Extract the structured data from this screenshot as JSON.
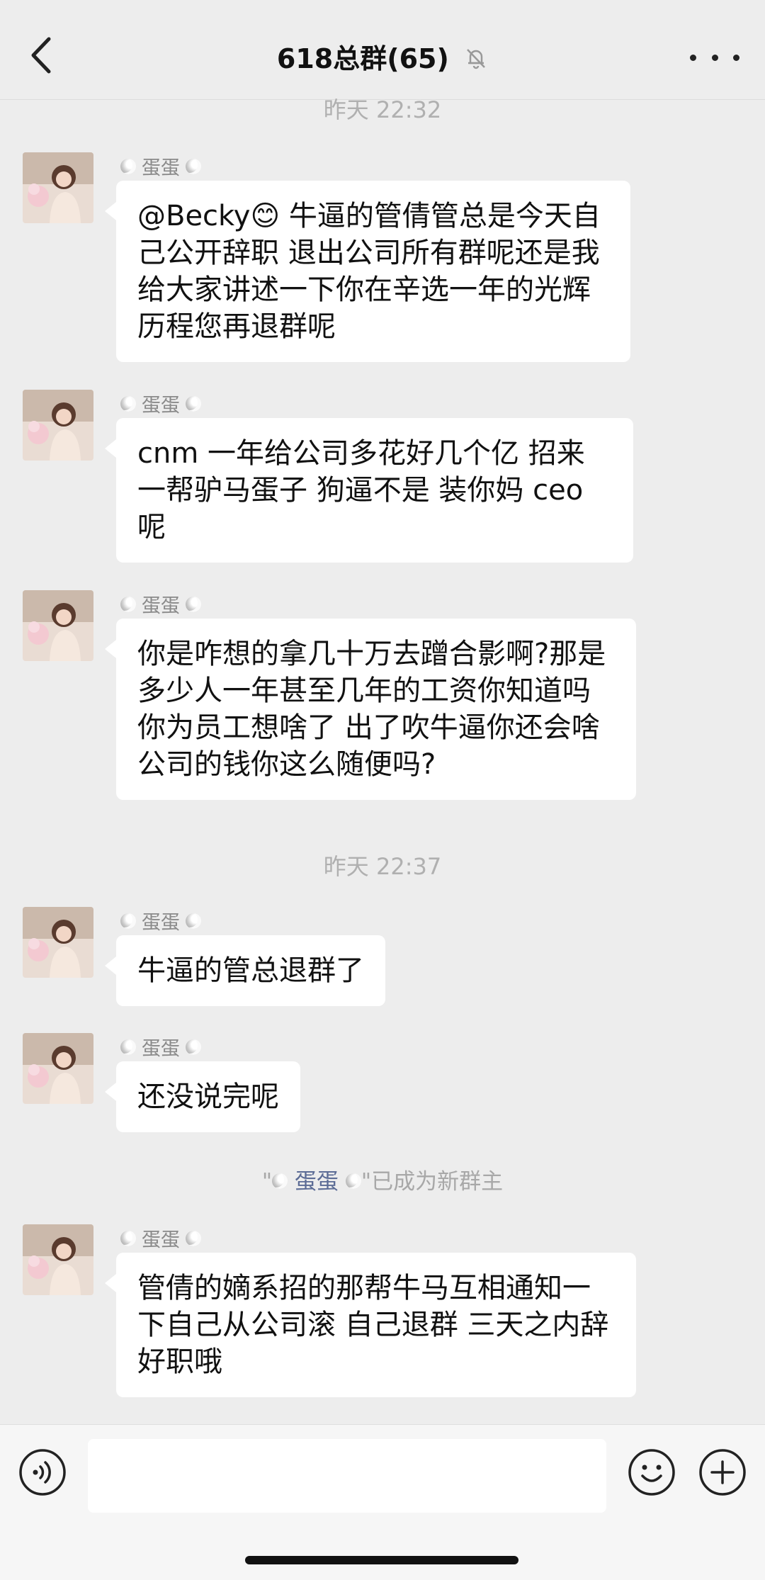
{
  "header": {
    "title": "618总群(65)",
    "back_icon": "chevron-left-icon",
    "mute_icon": "bell-muted-icon",
    "more_icon": "more-dots-icon"
  },
  "timestamps": [
    "昨天 22:32",
    "昨天 22:37"
  ],
  "sender_name": "蛋蛋",
  "messages": [
    {
      "text": "@Becky😊 牛逼的管倩管总是今天自己公开辞职 退出公司所有群呢还是我给大家讲述一下你在辛选一年的光辉历程您再退群呢"
    },
    {
      "text": "cnm 一年给公司多花好几个亿 招来一帮驴马蛋子 狗逼不是 装你妈 ceo 呢"
    },
    {
      "text": "你是咋想的拿几十万去蹭合影啊?那是多少人一年甚至几年的工资你知道吗 你为员工想啥了 出了吹牛逼你还会啥 公司的钱你这么随便吗?"
    },
    {
      "text": "牛逼的管总退群了"
    },
    {
      "text": "还没说完呢"
    },
    {
      "text": "管倩的嫡系招的那帮牛马互相通知一下自己从公司滚 自己退群 三天之内辞好职哦"
    }
  ],
  "system_notice": {
    "prefix": "\"",
    "name": "蛋蛋",
    "suffix": "\"已成为新群主"
  },
  "input_bar": {
    "voice_icon": "voice-icon",
    "emoji_icon": "emoji-icon",
    "plus_icon": "plus-icon",
    "placeholder": ""
  }
}
